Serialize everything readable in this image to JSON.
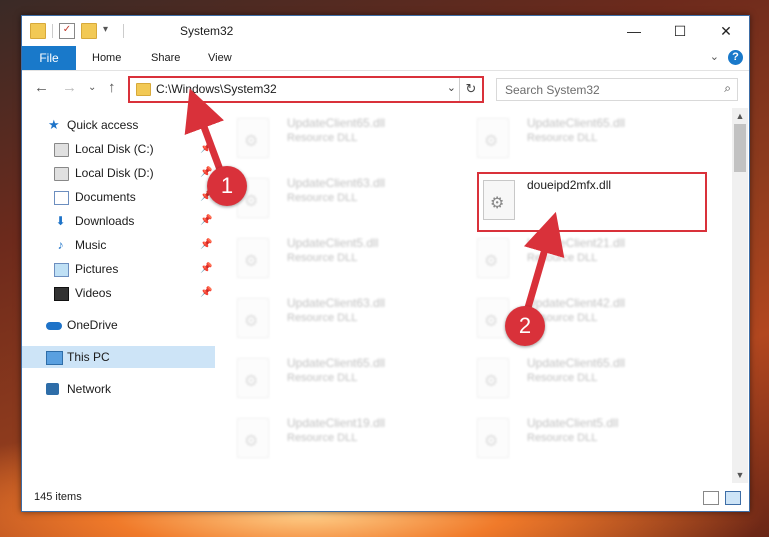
{
  "window": {
    "title": "System32",
    "controls": {
      "minimize": "—",
      "maximize": "☐",
      "close": "✕"
    }
  },
  "ribbon": {
    "file_tab": "File",
    "tabs": [
      "Home",
      "Share",
      "View"
    ],
    "help": "?"
  },
  "address": {
    "path": "C:\\Windows\\System32"
  },
  "search": {
    "placeholder": "Search System32"
  },
  "sidebar": {
    "items": [
      {
        "label": "Quick access",
        "icon": "star-icon"
      },
      {
        "label": "Local Disk (C:)",
        "icon": "drive-icon",
        "pinned": true
      },
      {
        "label": "Local Disk (D:)",
        "icon": "drive-icon",
        "pinned": true
      },
      {
        "label": "Documents",
        "icon": "documents-icon",
        "pinned": true
      },
      {
        "label": "Downloads",
        "icon": "downloads-icon",
        "pinned": true
      },
      {
        "label": "Music",
        "icon": "music-icon",
        "pinned": true
      },
      {
        "label": "Pictures",
        "icon": "pictures-icon",
        "pinned": true
      },
      {
        "label": "Videos",
        "icon": "videos-icon",
        "pinned": true
      },
      {
        "label": "OneDrive",
        "icon": "onedrive-icon"
      },
      {
        "label": "This PC",
        "icon": "this-pc-icon",
        "selected": true
      },
      {
        "label": "Network",
        "icon": "network-icon"
      }
    ]
  },
  "files": {
    "left_column": [
      {
        "name": "UpdateClient65.dll",
        "type": "Resource DLL"
      },
      {
        "name": "UpdateClient63.dll",
        "type": "Resource DLL"
      },
      {
        "name": "UpdateClient5.dll",
        "type": "Resource DLL"
      },
      {
        "name": "UpdateClient63.dll",
        "type": "Resource DLL"
      },
      {
        "name": "UpdateClient65.dll",
        "type": "Resource DLL"
      },
      {
        "name": "UpdateClient19.dll",
        "type": "Resource DLL"
      }
    ],
    "right_column": [
      {
        "name": "UpdateClient65.dll",
        "type": "Resource DLL"
      },
      {
        "name": "doueipd2mfx.dll",
        "type": ""
      },
      {
        "name": "UpdateClient21.dll",
        "type": "Resource DLL"
      },
      {
        "name": "UpdateClient42.dll",
        "type": "Resource DLL"
      },
      {
        "name": "UpdateClient65.dll",
        "type": "Resource DLL"
      },
      {
        "name": "UpdateClient5.dll",
        "type": "Resource DLL"
      }
    ]
  },
  "status": {
    "item_count": "145 items"
  },
  "callouts": [
    "1",
    "2"
  ],
  "colors": {
    "accent": "#1979ca",
    "highlight": "#d9313a",
    "selection": "#cde4f7"
  }
}
